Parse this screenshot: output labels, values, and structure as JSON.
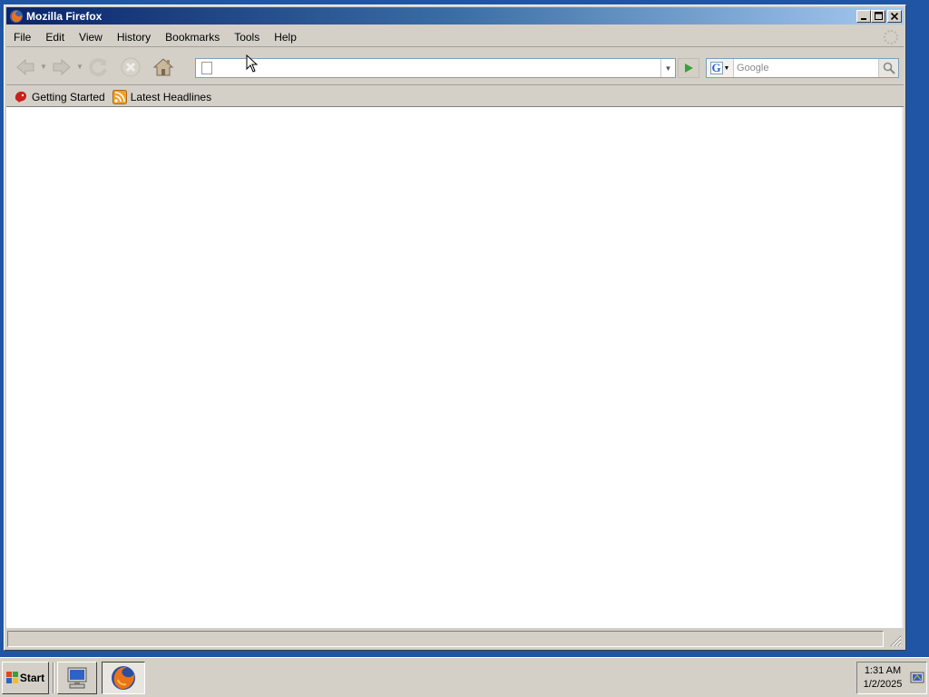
{
  "window": {
    "title": "Mozilla Firefox"
  },
  "menu": {
    "items": [
      "File",
      "Edit",
      "View",
      "History",
      "Bookmarks",
      "Tools",
      "Help"
    ]
  },
  "navigation": {
    "url_value": "",
    "search_placeholder": "Google",
    "search_engine_letter": "G"
  },
  "bookmarks": {
    "items": [
      {
        "label": "Getting Started",
        "icon": "getting-started-icon"
      },
      {
        "label": "Latest Headlines",
        "icon": "rss-feed-icon"
      }
    ]
  },
  "status": {
    "text": ""
  },
  "taskbar": {
    "start_label": "Start",
    "clock_time": "1:31 AM",
    "clock_date": "1/2/2025"
  },
  "colors": {
    "desktop": "#1f55a4",
    "title_gradient_start": "#0a246a",
    "title_gradient_end": "#a6caf0",
    "chrome": "#d4d0c8"
  }
}
